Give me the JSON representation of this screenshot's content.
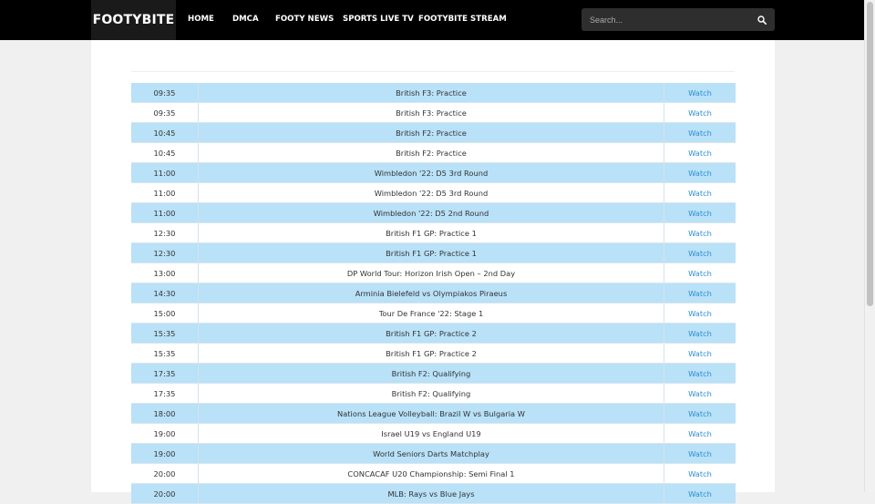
{
  "site": {
    "brand": "FOOTYBITE"
  },
  "nav": {
    "items": [
      {
        "label": "HOME"
      },
      {
        "label": "DMCA"
      },
      {
        "label": "FOOTY NEWS"
      },
      {
        "label": "SPORTS LIVE TV"
      },
      {
        "label": "FOOTYBITE STREAM"
      }
    ]
  },
  "search": {
    "placeholder": "Search...",
    "icon": "search-icon"
  },
  "colors": {
    "topbar": "#000000",
    "row_highlight": "#b9e1f8",
    "link": "#2f8fd0"
  },
  "schedule": {
    "rows": [
      {
        "time": "09:35",
        "event": "British F3: Practice",
        "link": "Watch"
      },
      {
        "time": "09:35",
        "event": "British F3: Practice",
        "link": "Watch"
      },
      {
        "time": "10:45",
        "event": "British F2: Practice",
        "link": "Watch"
      },
      {
        "time": "10:45",
        "event": "British F2: Practice",
        "link": "Watch"
      },
      {
        "time": "11:00",
        "event": "Wimbledon '22: D5 3rd Round",
        "link": "Watch"
      },
      {
        "time": "11:00",
        "event": "Wimbledon '22: D5 3rd Round",
        "link": "Watch"
      },
      {
        "time": "11:00",
        "event": "Wimbledon '22: D5 2nd Round",
        "link": "Watch"
      },
      {
        "time": "12:30",
        "event": "British F1 GP: Practice 1",
        "link": "Watch"
      },
      {
        "time": "12:30",
        "event": "British F1 GP: Practice 1",
        "link": "Watch"
      },
      {
        "time": "13:00",
        "event": "DP World Tour: Horizon Irish Open – 2nd Day",
        "link": "Watch"
      },
      {
        "time": "14:30",
        "event": "Arminia Bielefeld vs Olympiakos Piraeus",
        "link": "Watch"
      },
      {
        "time": "15:00",
        "event": "Tour De France '22: Stage 1",
        "link": "Watch"
      },
      {
        "time": "15:35",
        "event": "British F1 GP: Practice 2",
        "link": "Watch"
      },
      {
        "time": "15:35",
        "event": "British F1 GP: Practice 2",
        "link": "Watch"
      },
      {
        "time": "17:35",
        "event": "British F2: Qualifying",
        "link": "Watch"
      },
      {
        "time": "17:35",
        "event": "British F2: Qualifying",
        "link": "Watch"
      },
      {
        "time": "18:00",
        "event": "Nations League Volleyball: Brazil W vs Bulgaria W",
        "link": "Watch"
      },
      {
        "time": "19:00",
        "event": "Israel U19 vs England U19",
        "link": "Watch"
      },
      {
        "time": "19:00",
        "event": "World Seniors Darts Matchplay",
        "link": "Watch"
      },
      {
        "time": "20:00",
        "event": "CONCACAF U20 Championship: Semi Final 1",
        "link": "Watch"
      },
      {
        "time": "20:00",
        "event": "MLB: Rays vs Blue Jays",
        "link": "Watch"
      }
    ]
  }
}
